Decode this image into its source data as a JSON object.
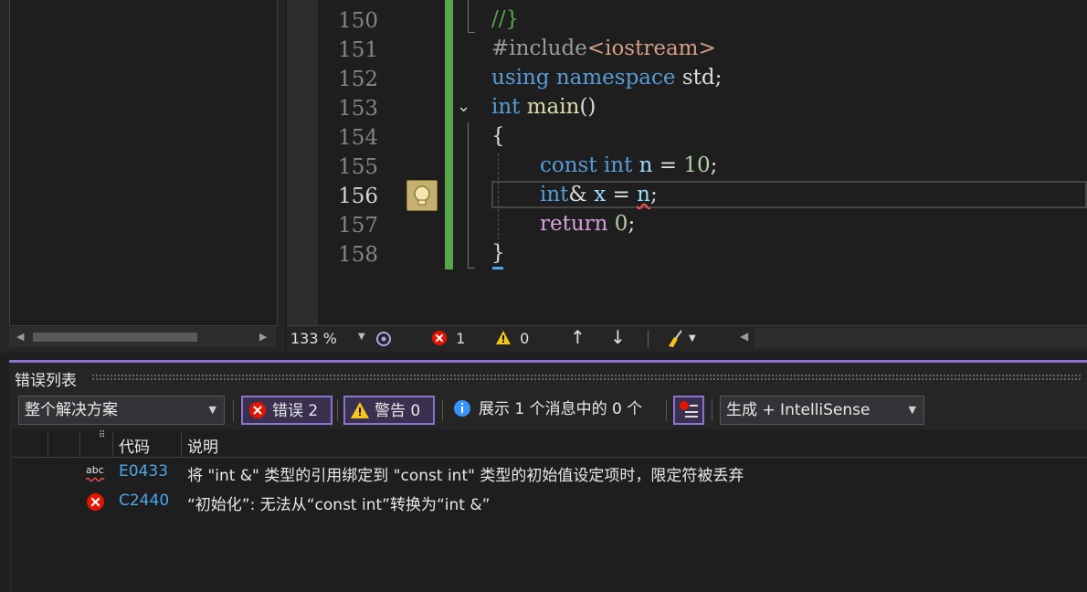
{
  "editor": {
    "lines": [
      {
        "num": "150"
      },
      {
        "num": "151"
      },
      {
        "num": "152"
      },
      {
        "num": "153"
      },
      {
        "num": "154"
      },
      {
        "num": "155"
      },
      {
        "num": "156"
      },
      {
        "num": "157"
      },
      {
        "num": "158"
      }
    ],
    "code": {
      "l150": "//}",
      "l151_a": "#include",
      "l151_b": "<iostream>",
      "l152_a": "using",
      "l152_b": "namespace",
      "l152_c": "std;",
      "l153_a": "int",
      "l153_b": "main",
      "l153_c": "()",
      "l154": "{",
      "l155_a": "const",
      "l155_b": "int",
      "l155_c": "n",
      "l155_d": "=",
      "l155_e": "10",
      "l155_f": ";",
      "l156_a": "int",
      "l156_b": "&",
      "l156_c": "x",
      "l156_d": "=",
      "l156_e": "n",
      "l156_f": ";",
      "l157_a": "return",
      "l157_b": "0",
      "l157_c": ";",
      "l158": "}"
    },
    "status": {
      "zoom": "133 %",
      "errors": "1",
      "warnings": "0"
    }
  },
  "error_list": {
    "title": "错误列表",
    "scope": "整个解决方案",
    "errors_toggle": "错误 2",
    "warnings_toggle": "警告 0",
    "messages": "展示 1 个消息中的 0 个",
    "source": "生成 + IntelliSense",
    "columns": {
      "code": "代码",
      "description": "说明"
    },
    "rows": [
      {
        "icon": "abc-squiggle-icon",
        "code": "E0433",
        "description": "将 \"int &\" 类型的引用绑定到 \"const int\" 类型的初始值设定项时，限定符被丢弃"
      },
      {
        "icon": "error-circle-icon",
        "code": "C2440",
        "description": "“初始化”: 无法从“const int”转换为“int &”"
      }
    ]
  },
  "colors": {
    "accent": "#8a74d0",
    "error": "#e51400",
    "warning": "#f5c518",
    "info": "#3794ff",
    "change_bar": "#57a64a"
  }
}
